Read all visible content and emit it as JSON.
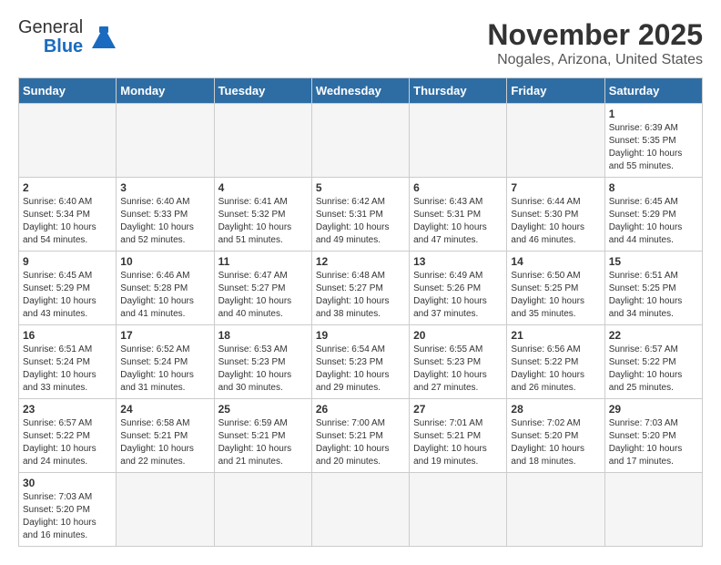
{
  "logo": {
    "line1": "General",
    "line2": "Blue"
  },
  "title": "November 2025",
  "subtitle": "Nogales, Arizona, United States",
  "weekdays": [
    "Sunday",
    "Monday",
    "Tuesday",
    "Wednesday",
    "Thursday",
    "Friday",
    "Saturday"
  ],
  "weeks": [
    [
      {
        "day": "",
        "info": ""
      },
      {
        "day": "",
        "info": ""
      },
      {
        "day": "",
        "info": ""
      },
      {
        "day": "",
        "info": ""
      },
      {
        "day": "",
        "info": ""
      },
      {
        "day": "",
        "info": ""
      },
      {
        "day": "1",
        "info": "Sunrise: 6:39 AM\nSunset: 5:35 PM\nDaylight: 10 hours and 55 minutes."
      }
    ],
    [
      {
        "day": "2",
        "info": "Sunrise: 6:40 AM\nSunset: 5:34 PM\nDaylight: 10 hours and 54 minutes."
      },
      {
        "day": "3",
        "info": "Sunrise: 6:40 AM\nSunset: 5:33 PM\nDaylight: 10 hours and 52 minutes."
      },
      {
        "day": "4",
        "info": "Sunrise: 6:41 AM\nSunset: 5:32 PM\nDaylight: 10 hours and 51 minutes."
      },
      {
        "day": "5",
        "info": "Sunrise: 6:42 AM\nSunset: 5:31 PM\nDaylight: 10 hours and 49 minutes."
      },
      {
        "day": "6",
        "info": "Sunrise: 6:43 AM\nSunset: 5:31 PM\nDaylight: 10 hours and 47 minutes."
      },
      {
        "day": "7",
        "info": "Sunrise: 6:44 AM\nSunset: 5:30 PM\nDaylight: 10 hours and 46 minutes."
      },
      {
        "day": "8",
        "info": "Sunrise: 6:45 AM\nSunset: 5:29 PM\nDaylight: 10 hours and 44 minutes."
      }
    ],
    [
      {
        "day": "9",
        "info": "Sunrise: 6:45 AM\nSunset: 5:29 PM\nDaylight: 10 hours and 43 minutes."
      },
      {
        "day": "10",
        "info": "Sunrise: 6:46 AM\nSunset: 5:28 PM\nDaylight: 10 hours and 41 minutes."
      },
      {
        "day": "11",
        "info": "Sunrise: 6:47 AM\nSunset: 5:27 PM\nDaylight: 10 hours and 40 minutes."
      },
      {
        "day": "12",
        "info": "Sunrise: 6:48 AM\nSunset: 5:27 PM\nDaylight: 10 hours and 38 minutes."
      },
      {
        "day": "13",
        "info": "Sunrise: 6:49 AM\nSunset: 5:26 PM\nDaylight: 10 hours and 37 minutes."
      },
      {
        "day": "14",
        "info": "Sunrise: 6:50 AM\nSunset: 5:25 PM\nDaylight: 10 hours and 35 minutes."
      },
      {
        "day": "15",
        "info": "Sunrise: 6:51 AM\nSunset: 5:25 PM\nDaylight: 10 hours and 34 minutes."
      }
    ],
    [
      {
        "day": "16",
        "info": "Sunrise: 6:51 AM\nSunset: 5:24 PM\nDaylight: 10 hours and 33 minutes."
      },
      {
        "day": "17",
        "info": "Sunrise: 6:52 AM\nSunset: 5:24 PM\nDaylight: 10 hours and 31 minutes."
      },
      {
        "day": "18",
        "info": "Sunrise: 6:53 AM\nSunset: 5:23 PM\nDaylight: 10 hours and 30 minutes."
      },
      {
        "day": "19",
        "info": "Sunrise: 6:54 AM\nSunset: 5:23 PM\nDaylight: 10 hours and 29 minutes."
      },
      {
        "day": "20",
        "info": "Sunrise: 6:55 AM\nSunset: 5:23 PM\nDaylight: 10 hours and 27 minutes."
      },
      {
        "day": "21",
        "info": "Sunrise: 6:56 AM\nSunset: 5:22 PM\nDaylight: 10 hours and 26 minutes."
      },
      {
        "day": "22",
        "info": "Sunrise: 6:57 AM\nSunset: 5:22 PM\nDaylight: 10 hours and 25 minutes."
      }
    ],
    [
      {
        "day": "23",
        "info": "Sunrise: 6:57 AM\nSunset: 5:22 PM\nDaylight: 10 hours and 24 minutes."
      },
      {
        "day": "24",
        "info": "Sunrise: 6:58 AM\nSunset: 5:21 PM\nDaylight: 10 hours and 22 minutes."
      },
      {
        "day": "25",
        "info": "Sunrise: 6:59 AM\nSunset: 5:21 PM\nDaylight: 10 hours and 21 minutes."
      },
      {
        "day": "26",
        "info": "Sunrise: 7:00 AM\nSunset: 5:21 PM\nDaylight: 10 hours and 20 minutes."
      },
      {
        "day": "27",
        "info": "Sunrise: 7:01 AM\nSunset: 5:21 PM\nDaylight: 10 hours and 19 minutes."
      },
      {
        "day": "28",
        "info": "Sunrise: 7:02 AM\nSunset: 5:20 PM\nDaylight: 10 hours and 18 minutes."
      },
      {
        "day": "29",
        "info": "Sunrise: 7:03 AM\nSunset: 5:20 PM\nDaylight: 10 hours and 17 minutes."
      }
    ],
    [
      {
        "day": "30",
        "info": "Sunrise: 7:03 AM\nSunset: 5:20 PM\nDaylight: 10 hours and 16 minutes."
      },
      {
        "day": "",
        "info": ""
      },
      {
        "day": "",
        "info": ""
      },
      {
        "day": "",
        "info": ""
      },
      {
        "day": "",
        "info": ""
      },
      {
        "day": "",
        "info": ""
      },
      {
        "day": "",
        "info": ""
      }
    ]
  ]
}
